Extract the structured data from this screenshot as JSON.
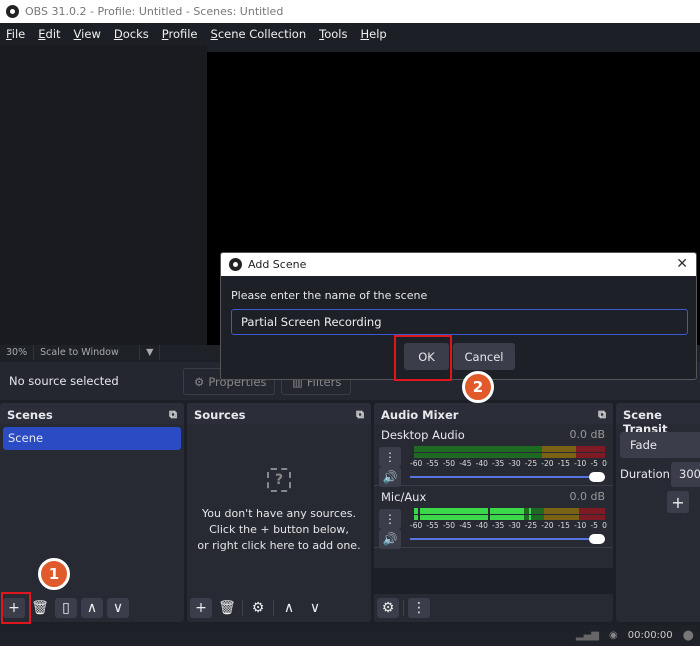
{
  "window": {
    "title": "OBS 31.0.2 - Profile: Untitled - Scenes: Untitled"
  },
  "menu": [
    "File",
    "Edit",
    "View",
    "Docks",
    "Profile",
    "Scene Collection",
    "Tools",
    "Help"
  ],
  "preview": {
    "zoom": "30%",
    "scale_mode": "Scale to Window"
  },
  "context": {
    "status": "No source selected",
    "properties": "Properties",
    "filters": "Filters"
  },
  "scenes": {
    "title": "Scenes",
    "items": [
      "Scene"
    ]
  },
  "sources": {
    "title": "Sources",
    "empty_lines": [
      "You don't have any sources.",
      "Click the + button below,",
      "or right click here to add one."
    ]
  },
  "mixer": {
    "title": "Audio Mixer",
    "ticks": [
      "-60",
      "-55",
      "-50",
      "-45",
      "-40",
      "-35",
      "-30",
      "-25",
      "-20",
      "-15",
      "-10",
      "-5",
      "0"
    ],
    "channels": [
      {
        "name": "Desktop Audio",
        "level": "0.0 dB",
        "volume_percent": 100
      },
      {
        "name": "Mic/Aux",
        "level": "0.0 dB",
        "volume_percent": 100
      }
    ]
  },
  "transitions": {
    "title": "Scene Transit",
    "selected": "Fade",
    "duration_label": "Duration",
    "duration_value": "300"
  },
  "status": {
    "time": "00:00:00"
  },
  "dialog": {
    "title": "Add Scene",
    "prompt": "Please enter the name of the scene",
    "value": "Partial Screen Recording",
    "ok": "OK",
    "cancel": "Cancel"
  },
  "annotations": {
    "step1": "1",
    "step2": "2",
    "highlight_color": "#e0161f",
    "badge_color": "#e05a2b"
  }
}
